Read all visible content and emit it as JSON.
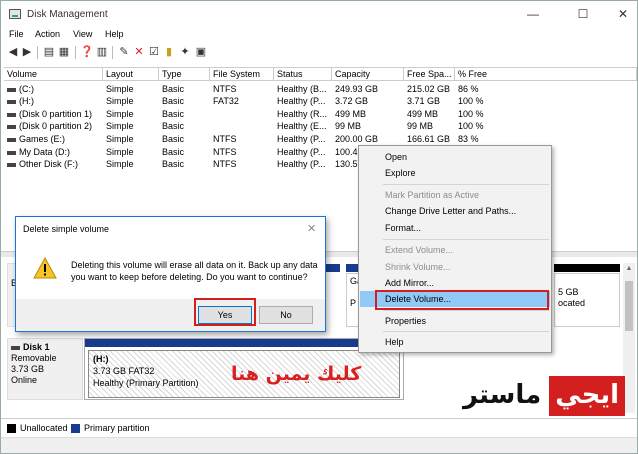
{
  "window": {
    "title": "Disk Management",
    "minimize": "—",
    "maximize": "☐",
    "close": "✕"
  },
  "menu": [
    "File",
    "Action",
    "View",
    "Help"
  ],
  "table": {
    "headers": [
      "Volume",
      "Layout",
      "Type",
      "File System",
      "Status",
      "Capacity",
      "Free Spa...",
      "% Free"
    ],
    "rows": [
      [
        "(C:)",
        "Simple",
        "Basic",
        "NTFS",
        "Healthy (B...",
        "249.93 GB",
        "215.02 GB",
        "86 %"
      ],
      [
        "(H:)",
        "Simple",
        "Basic",
        "FAT32",
        "Healthy (P...",
        "3.72 GB",
        "3.71 GB",
        "100 %"
      ],
      [
        "(Disk 0 partition 1)",
        "Simple",
        "Basic",
        "",
        "Healthy (R...",
        "499 MB",
        "499 MB",
        "100 %"
      ],
      [
        "(Disk 0 partition 2)",
        "Simple",
        "Basic",
        "",
        "Healthy (E...",
        "99 MB",
        "99 MB",
        "100 %"
      ],
      [
        "Games (E:)",
        "Simple",
        "Basic",
        "NTFS",
        "Healthy (P...",
        "200.00 GB",
        "166.61 GB",
        "83 %"
      ],
      [
        "My Data (D:)",
        "Simple",
        "Basic",
        "NTFS",
        "Healthy (P...",
        "100.49",
        "",
        ""
      ],
      [
        "Other Disk (F:)",
        "Simple",
        "Basic",
        "NTFS",
        "Healthy (P...",
        "130.57",
        "",
        ""
      ]
    ]
  },
  "disk0": {
    "label_initial": "B",
    "partition_g_partial": "Ga",
    "partition_g_type": "P",
    "right_size": "5 GB",
    "right_status": "ocated"
  },
  "disk1": {
    "name": "Disk 1",
    "type": "Removable",
    "size": "3.73 GB",
    "status": "Online",
    "partition": {
      "label": "(H:)",
      "detail": "3.73 GB FAT32",
      "status": "Healthy (Primary Partition)"
    }
  },
  "overlay_arabic": "كليك يمين هنا",
  "watermark": {
    "black": "ماستر",
    "red": "ايجي"
  },
  "legend": [
    {
      "label": "Unallocated",
      "color": "#000000"
    },
    {
      "label": "Primary partition",
      "color": "#183b8e"
    }
  ],
  "context_menu": {
    "items": [
      {
        "label": "Open",
        "disabled": false
      },
      {
        "label": "Explore",
        "disabled": false
      },
      {
        "label": "Mark Partition as Active",
        "disabled": true
      },
      {
        "label": "Change Drive Letter and Paths...",
        "disabled": false
      },
      {
        "label": "Format...",
        "disabled": false
      },
      {
        "label": "Extend Volume...",
        "disabled": true
      },
      {
        "label": "Shrink Volume...",
        "disabled": true
      },
      {
        "label": "Add Mirror...",
        "disabled": false
      },
      {
        "label": "Delete Volume...",
        "disabled": false,
        "highlighted": true
      },
      {
        "label": "Properties",
        "disabled": false
      },
      {
        "label": "Help",
        "disabled": false
      }
    ]
  },
  "dialog": {
    "title": "Delete simple volume",
    "message": "Deleting this volume will erase all data on it. Back up any data you want to keep before deleting. Do you want to continue?",
    "yes": "Yes",
    "no": "No"
  },
  "colors": {
    "accent": "#0078d7",
    "highlight_red": "#d41f1f",
    "menu_hover": "#91c9f7",
    "partition_bar": "#183b8e"
  }
}
